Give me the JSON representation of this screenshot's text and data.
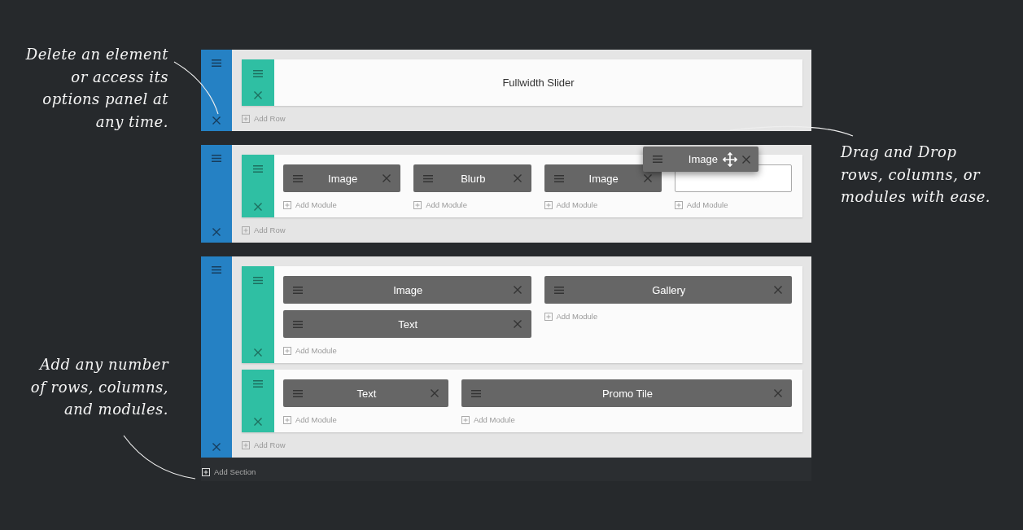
{
  "annotations": {
    "left_top": "Delete an element\nor access its\noptions panel at\nany time.",
    "left_bottom": "Add any number\nof rows, columns,\nand modules.",
    "right": "Drag and Drop\nrows, columns, or\nmodules with ease."
  },
  "sections": [
    {
      "rows": [
        {
          "kind": "fullwidth",
          "label": "Fullwidth Slider"
        }
      ],
      "add_row": "Add Row"
    },
    {
      "rows": [
        {
          "kind": "quarters",
          "columns": [
            {
              "modules": [
                "Image"
              ],
              "add_module": "Add Module"
            },
            {
              "modules": [
                "Blurb"
              ],
              "add_module": "Add Module"
            },
            {
              "modules": [
                "Image"
              ],
              "add_module": "Add Module"
            },
            {
              "drop_target": true,
              "add_module": "Add Module"
            }
          ]
        }
      ],
      "add_row": "Add Row"
    },
    {
      "rows": [
        {
          "kind": "halves",
          "columns": [
            {
              "modules": [
                "Image",
                "Text"
              ],
              "add_module": "Add Module"
            },
            {
              "modules": [
                "Gallery"
              ],
              "add_module": "Add Module"
            }
          ]
        },
        {
          "kind": "third_two_thirds",
          "columns": [
            {
              "modules": [
                "Text"
              ],
              "add_module": "Add Module"
            },
            {
              "modules": [
                "Promo Tile"
              ],
              "add_module": "Add Module"
            }
          ]
        }
      ],
      "add_row": "Add Row"
    }
  ],
  "dragged_module": {
    "label": "Image"
  },
  "add_section": "Add Section"
}
